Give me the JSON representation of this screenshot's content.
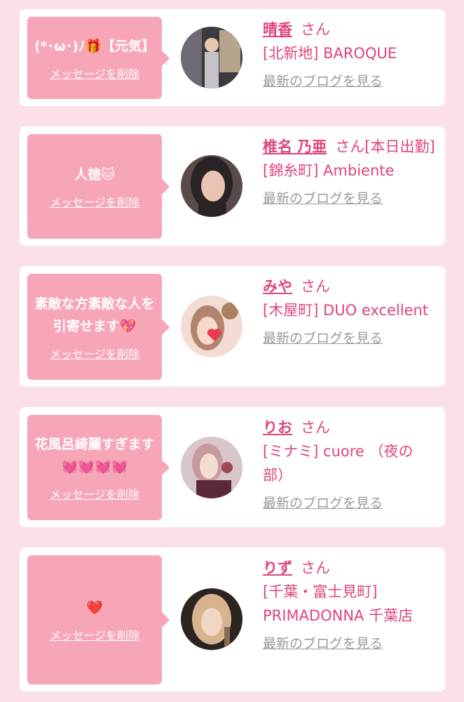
{
  "messages": [
    {
      "text": "(*･ω･)ﾉ🎁【元気】",
      "delete_label": "メッセージを削除",
      "name": "晴香",
      "suffix": "さん",
      "shop": "[北新地] BAROQUE",
      "blog_label": "最新のブログを見る",
      "avatar_colors": [
        "#3b3a3f",
        "#b7a48c",
        "#6d6a73"
      ]
    },
    {
      "text": "人徳🐱",
      "delete_label": "メッセージを削除",
      "name": "椎名 乃亜",
      "suffix": "さん[本日出勤]",
      "shop": "[錦糸町] Ambiente",
      "blog_label": "最新のブログを見る",
      "avatar_colors": [
        "#2a2326",
        "#e9c3b4",
        "#5a4b4a"
      ]
    },
    {
      "text": "素敵な方素敵な人を引寄せます💖",
      "delete_label": "メッセージを削除",
      "name": "みや",
      "suffix": "さん",
      "shop": "[木屋町] DUO excellent",
      "blog_label": "最新のブログを見る",
      "avatar_colors": [
        "#f2dcd3",
        "#b4836b",
        "#e83c4e"
      ]
    },
    {
      "text": "花風呂綺麗すぎます💓💓💓💓",
      "delete_label": "メッセージを削除",
      "name": "りお",
      "suffix": "さん",
      "shop": "[ミナミ] cuore （夜の部）",
      "blog_label": "最新のブログを見る",
      "avatar_colors": [
        "#d9c6cb",
        "#a0475a",
        "#5b2a3a"
      ]
    },
    {
      "text": "❤️",
      "delete_label": "メッセージを削除",
      "name": "りず",
      "suffix": "さん",
      "shop": "[千葉・富士見町] PRIMADONNA 千葉店",
      "blog_label": "最新のブログを見る",
      "avatar_colors": [
        "#2b2421",
        "#d8b48e",
        "#8a6b55"
      ]
    }
  ]
}
